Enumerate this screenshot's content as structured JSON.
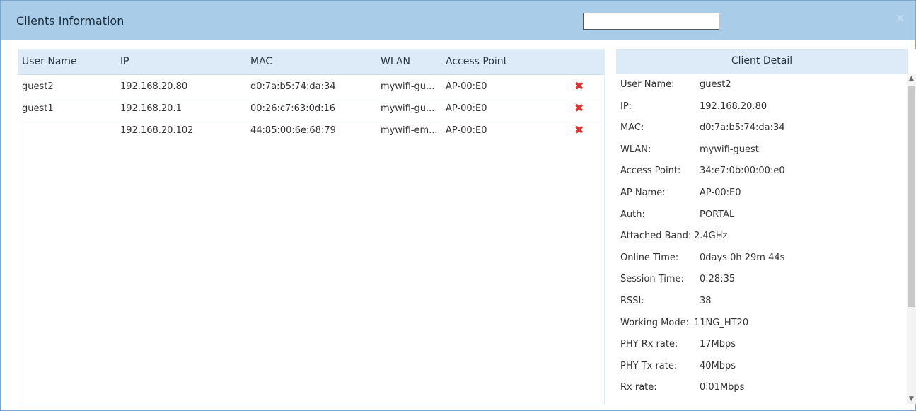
{
  "dialog": {
    "title": "Clients Information",
    "search_value": "",
    "close_glyph": "×"
  },
  "table": {
    "headers": [
      "User Name",
      "IP",
      "MAC",
      "WLAN",
      "Access Point"
    ],
    "rows": [
      {
        "user": "guest2",
        "ip": "192.168.20.80",
        "mac": "d0:7a:b5:74:da:34",
        "wlan": "mywifi-gu...",
        "ap": "AP-00:E0"
      },
      {
        "user": "guest1",
        "ip": "192.168.20.1",
        "mac": "00:26:c7:63:0d:16",
        "wlan": "mywifi-gu...",
        "ap": "AP-00:E0"
      },
      {
        "user": "",
        "ip": "192.168.20.102",
        "mac": "44:85:00:6e:68:79",
        "wlan": "mywifi-em...",
        "ap": "AP-00:E0"
      }
    ],
    "delete_glyph": "✖"
  },
  "detail": {
    "title": "Client Detail",
    "fields": [
      {
        "label": "User Name:",
        "value": "guest2"
      },
      {
        "label": "IP:",
        "value": "192.168.20.80"
      },
      {
        "label": "MAC:",
        "value": "d0:7a:b5:74:da:34"
      },
      {
        "label": "WLAN:",
        "value": "mywifi-guest"
      },
      {
        "label": "Access Point:",
        "value": "34:e7:0b:00:00:e0"
      },
      {
        "label": "AP Name:",
        "value": "AP-00:E0"
      },
      {
        "label": "Auth:",
        "value": "PORTAL"
      },
      {
        "label": "Attached Band:",
        "value": "2.4GHz"
      },
      {
        "label": "Online Time:",
        "value": "0days 0h 29m 44s"
      },
      {
        "label": "Session Time:",
        "value": "0:28:35"
      },
      {
        "label": "RSSI:",
        "value": "38"
      },
      {
        "label": "Working Mode:",
        "value": "11NG_HT20"
      },
      {
        "label": "PHY Rx rate:",
        "value": "17Mbps"
      },
      {
        "label": "PHY Tx rate:",
        "value": "40Mbps"
      },
      {
        "label": "Rx rate:",
        "value": "0.01Mbps"
      }
    ]
  },
  "colors": {
    "titlebar": "#a9cde9",
    "header": "#dcebf7",
    "delete": "#e0312f"
  }
}
